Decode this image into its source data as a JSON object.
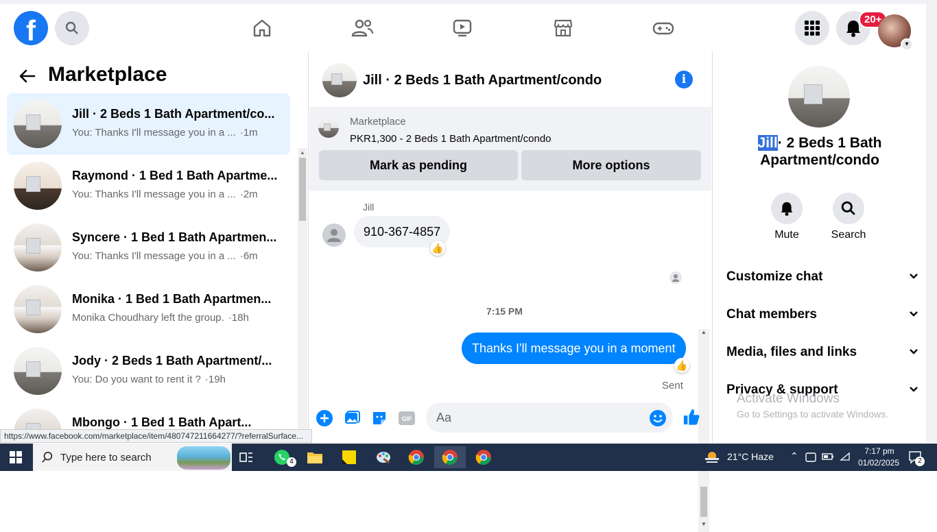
{
  "topbar": {
    "logo_letter": "f",
    "notification_badge": "20+"
  },
  "left": {
    "title": "Marketplace",
    "conversations": [
      {
        "title": "Jill · 2 Beds 1 Bath Apartment/co...",
        "snippet": "You: Thanks I'll message you in a ...",
        "time": "·1m",
        "active": true
      },
      {
        "title": "Raymond · 1 Bed 1 Bath Apartme...",
        "snippet": "You: Thanks I'll message you in a ...",
        "time": "·2m"
      },
      {
        "title": "Syncere · 1 Bed 1 Bath Apartmen...",
        "snippet": "You: Thanks I'll message you in a ...",
        "time": "·6m"
      },
      {
        "title": "Monika · 1 Bed 1 Bath Apartmen...",
        "snippet": "Monika Choudhary left the group.",
        "time": "·18h"
      },
      {
        "title": "Jody · 2 Beds 1 Bath Apartment/...",
        "snippet": "You: Do you want to rent it ?",
        "time": "·19h"
      },
      {
        "title": "Mbongo · 1 Bed 1 Bath Apart...",
        "snippet": "",
        "time": ""
      }
    ]
  },
  "chat": {
    "title": "Jill · 2 Beds 1 Bath Apartment/condo",
    "marketplace_label": "Marketplace",
    "listing": "PKR1,300 - 2 Beds 1 Bath Apartment/condo",
    "mark_pending": "Mark as pending",
    "more_options": "More options",
    "sender": "Jill",
    "incoming_message": "910-367-4857",
    "time_divider": "7:15 PM",
    "outgoing_message": "Thanks I'll message you in a moment",
    "sent_label": "Sent",
    "input_placeholder": "Aa"
  },
  "right": {
    "title_highlight": "Jill",
    "title_rest": "· 2 Beds 1 Bath Apartment/condo",
    "mute_label": "Mute",
    "search_label": "Search",
    "sections": [
      "Customize chat",
      "Chat members",
      "Media, files and links",
      "Privacy & support"
    ],
    "watermark_title": "Activate Windows",
    "watermark_sub": "Go to Settings to activate Windows."
  },
  "status_url": "https://www.facebook.com/marketplace/item/480747211664277/?referralSurface...",
  "taskbar": {
    "search_placeholder": "Type here to search",
    "whatsapp_badge": "4",
    "weather": "21°C  Haze",
    "time": "7:17 pm",
    "date": "01/02/2025",
    "notif_count": "2"
  }
}
